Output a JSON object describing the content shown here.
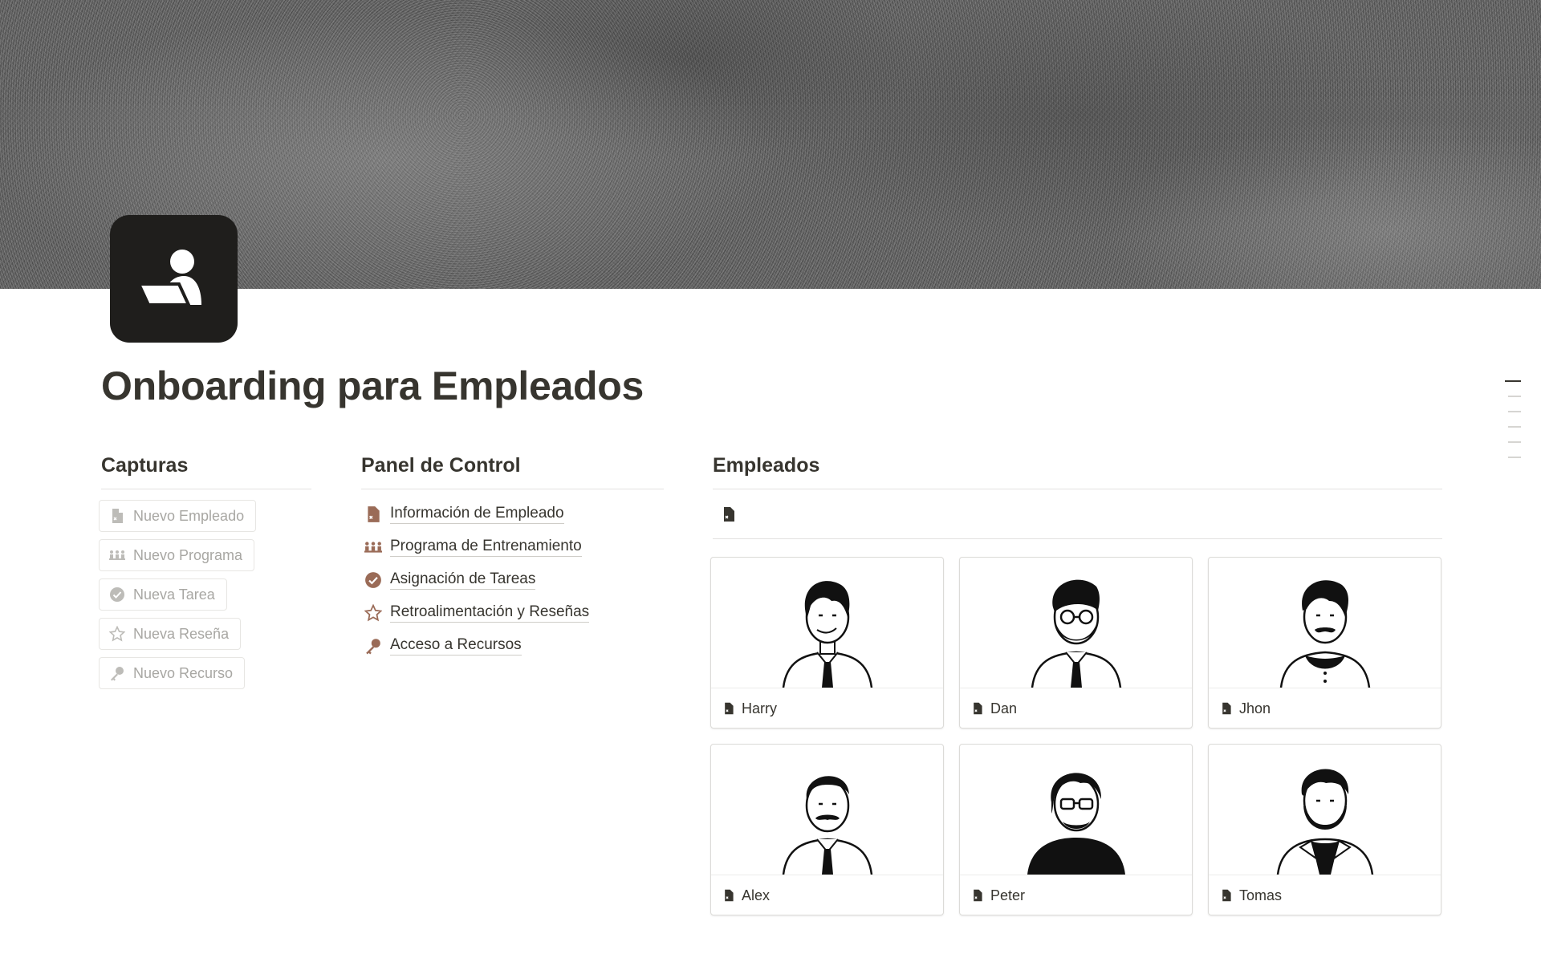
{
  "page": {
    "title": "Onboarding para Empleados",
    "icon": "person-at-laptop-icon"
  },
  "capturas": {
    "heading": "Capturas",
    "buttons": [
      {
        "label": "Nuevo Empleado",
        "icon": "document-icon"
      },
      {
        "label": "Nuevo Programa",
        "icon": "group-icon"
      },
      {
        "label": "Nueva Tarea",
        "icon": "check-circle-icon"
      },
      {
        "label": "Nueva Reseña",
        "icon": "star-icon"
      },
      {
        "label": "Nuevo Recurso",
        "icon": "key-icon"
      }
    ]
  },
  "panel": {
    "heading": "Panel de Control",
    "links": [
      {
        "label": "Información de Empleado",
        "icon": "document-icon"
      },
      {
        "label": "Programa de Entrenamiento",
        "icon": "group-icon"
      },
      {
        "label": "Asignación de Tareas",
        "icon": "check-circle-icon"
      },
      {
        "label": "Retroalimentación y Reseñas",
        "icon": "star-icon"
      },
      {
        "label": "Acceso a Recursos",
        "icon": "key-icon"
      }
    ]
  },
  "empleados": {
    "heading": "Empleados",
    "view_icon": "document-icon",
    "cards": [
      {
        "name": "Harry",
        "avatar": "man-tie-avatar"
      },
      {
        "name": "Dan",
        "avatar": "bearded-glasses-avatar"
      },
      {
        "name": "Jhon",
        "avatar": "mustache-collar-avatar"
      },
      {
        "name": "Alex",
        "avatar": "mustache-tie-avatar"
      },
      {
        "name": "Peter",
        "avatar": "glasses-tshirt-avatar"
      },
      {
        "name": "Tomas",
        "avatar": "bearded-jacket-avatar"
      }
    ]
  },
  "colors": {
    "text": "#37352f",
    "accent_brown": "#9a6b57",
    "muted": "#a8a7a3"
  }
}
